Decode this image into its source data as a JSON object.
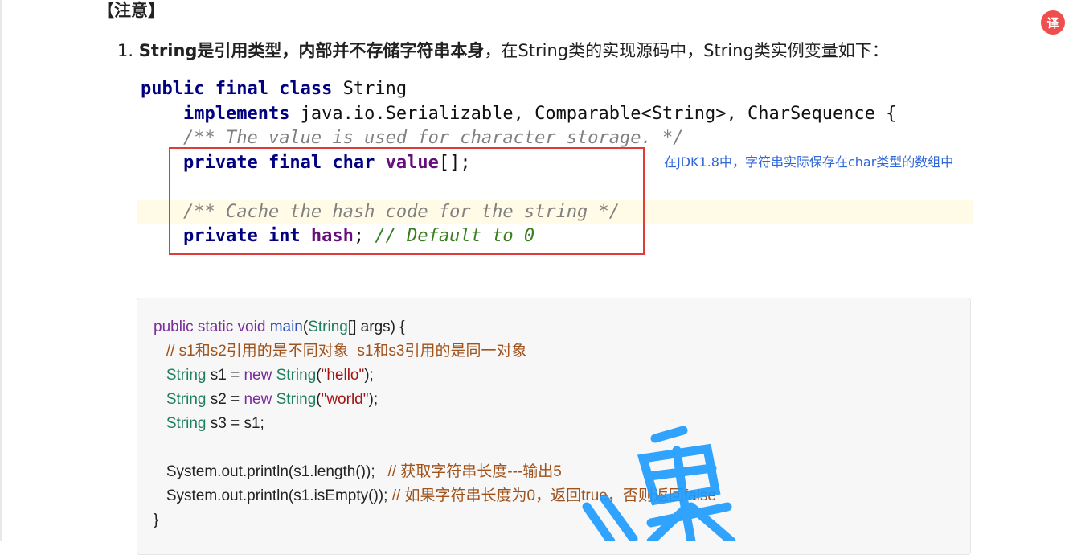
{
  "heading": "【注意】",
  "list": {
    "number": "1.",
    "bold_text": "String是引用类型，内部并不存储字符串本身",
    "rest_text": "，在String类的实现源码中，String类实例变量如下："
  },
  "code_block_1": {
    "lines": {
      "l1_kw": "public final class",
      "l1_rest": " String",
      "l2_indent": "    ",
      "l2_kw": "implements",
      "l2_rest": " java.io.Serializable, Comparable<String>, CharSequence {",
      "l3_indent": "    ",
      "l3_comment": "/** The value is used for character storage. */",
      "l4_indent": "    ",
      "l4_kw": "private final char",
      "l4_var": " value",
      "l4_rest": "[];",
      "l6_indent": "    ",
      "l6_comment": "/** Cache the hash code for the string */",
      "l7_indent": "    ",
      "l7_kw": "private int",
      "l7_var": " hash",
      "l7_rest": "; ",
      "l7_comment": "// Default to 0"
    }
  },
  "annotation": "在JDK1.8中，字符串实际保存在char类型的数组中",
  "code_block_2": {
    "m_kw": "public static void ",
    "m_fn": "main",
    "m_p1": "(",
    "m_ty": "String",
    "m_p2": "[] args) {",
    "c1": "   // s1和s2引用的是不同对象  s1和s3引用的是同一对象",
    "s1_ty": "   String",
    "s1_a": " s1 = ",
    "s1_kw": "new ",
    "s1_ty2": "String",
    "s1_b": "(",
    "s1_str": "\"hello\"",
    "s1_c": ");",
    "s2_ty": "   String",
    "s2_a": " s2 = ",
    "s2_kw": "new ",
    "s2_ty2": "String",
    "s2_b": "(",
    "s2_str": "\"world\"",
    "s2_c": ");",
    "s3_ty": "   String",
    "s3_a": " s3 = s1;",
    "p1": "   System.out.println(s1.length());   ",
    "p1_cm": "// 获取字符串长度---输出5",
    "p2": "   System.out.println(s1.isEmpty()); ",
    "p2_cm": "// 如果字符串长度为0，返回true，否则返回false",
    "close": "}"
  },
  "badge_icon": "translate-icon",
  "badge_text": "译",
  "colors": {
    "annotation": "#2f66d8",
    "red_box": "#e03c3c",
    "keyword": "#000080",
    "watermark": "#1a9bff"
  }
}
